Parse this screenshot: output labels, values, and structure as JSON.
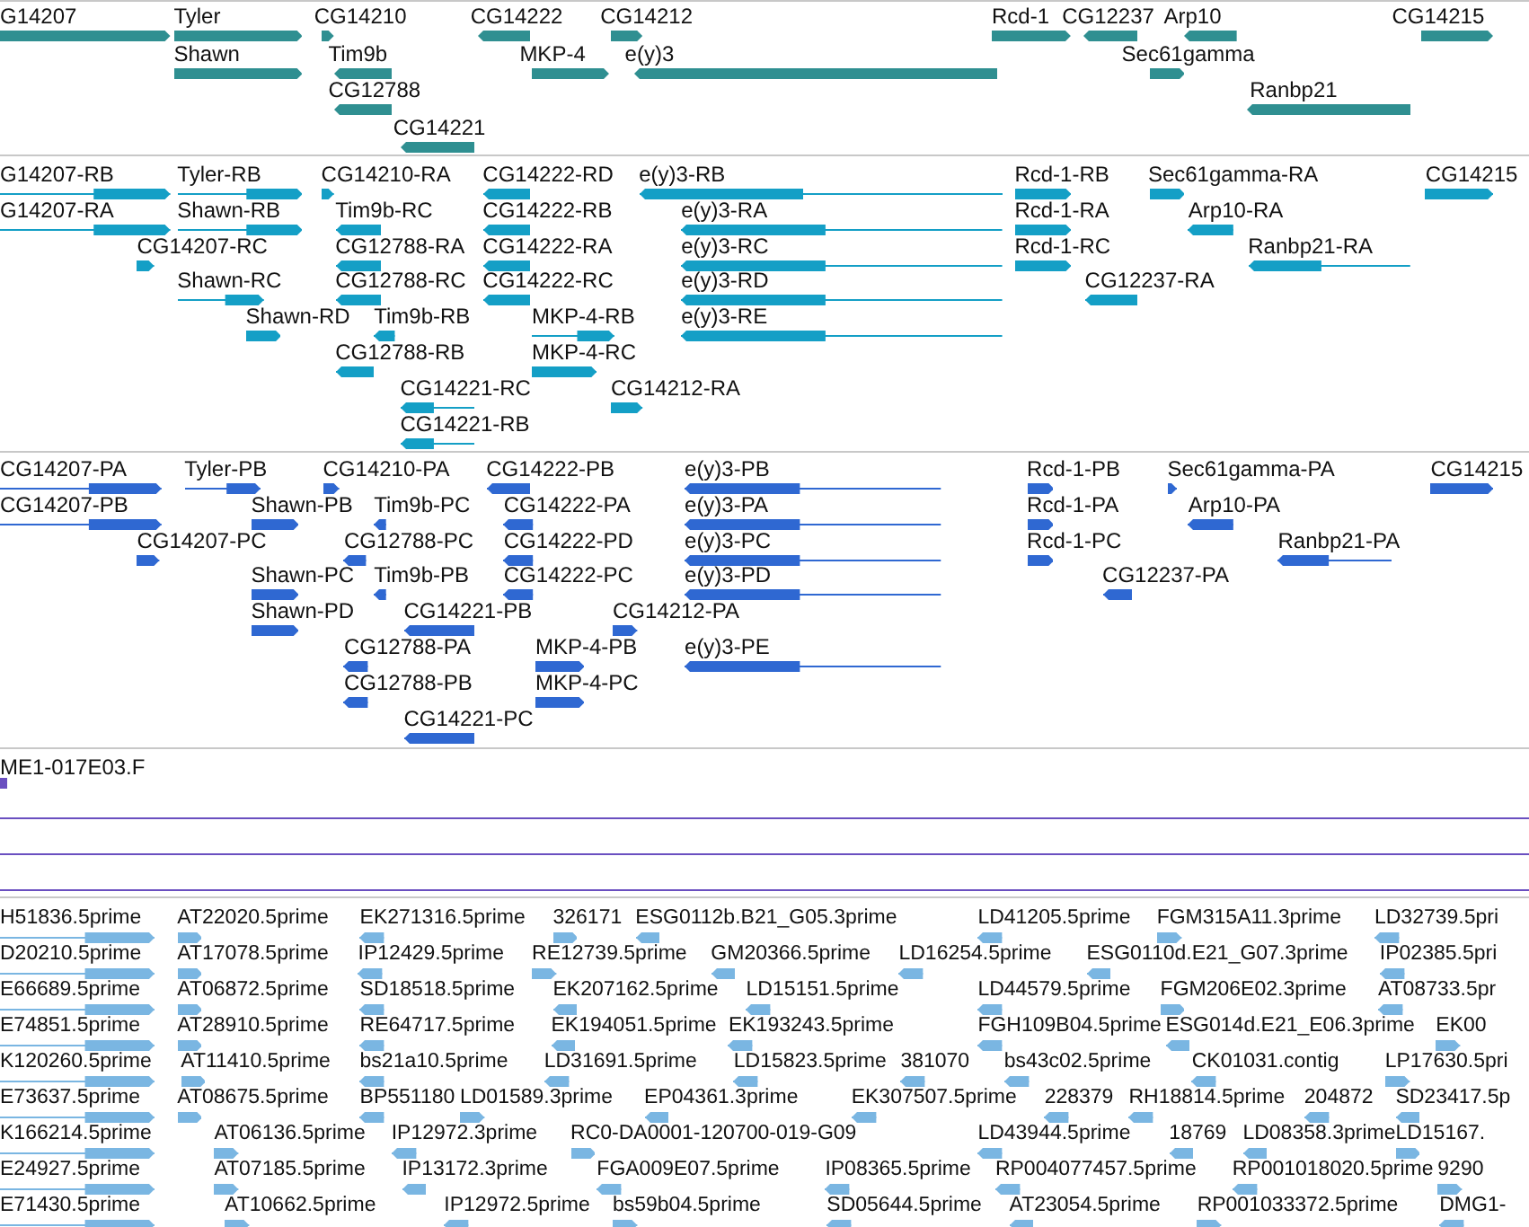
{
  "tracks": [
    {
      "kind": "gene",
      "features": [
        {
          "label": "G14207",
          "reverse": false
        },
        {
          "label": "Tyler",
          "reverse": false
        },
        {
          "label": "CG14210",
          "reverse": false
        },
        {
          "label": "CG14222",
          "reverse": true
        },
        {
          "label": "CG14212",
          "reverse": false
        },
        {
          "label": "Rcd-1",
          "reverse": false
        },
        {
          "label": "CG12237",
          "reverse": true
        },
        {
          "label": "Arp10",
          "reverse": true
        },
        {
          "label": "CG14215",
          "reverse": false
        },
        {
          "label": "Shawn",
          "reverse": false
        },
        {
          "label": "Tim9b",
          "reverse": true
        },
        {
          "label": "MKP-4",
          "reverse": false
        },
        {
          "label": "e(y)3",
          "reverse": true
        },
        {
          "label": "Sec61gamma",
          "reverse": false
        },
        {
          "label": "CG12788",
          "reverse": true
        },
        {
          "label": "Ranbp21",
          "reverse": true
        },
        {
          "label": "CG14221",
          "reverse": true
        }
      ]
    },
    {
      "kind": "transcript",
      "features": [
        {
          "label": "G14207-RB",
          "reverse": false
        },
        {
          "label": "Tyler-RB",
          "reverse": false
        },
        {
          "label": "CG14210-RA",
          "reverse": false
        },
        {
          "label": "CG14222-RD",
          "reverse": true
        },
        {
          "label": "e(y)3-RB",
          "reverse": true
        },
        {
          "label": "Rcd-1-RB",
          "reverse": false
        },
        {
          "label": "Sec61gamma-RA",
          "reverse": false
        },
        {
          "label": "CG14215",
          "reverse": false
        },
        {
          "label": "G14207-RA",
          "reverse": false
        },
        {
          "label": "Shawn-RB",
          "reverse": false
        },
        {
          "label": "Tim9b-RC",
          "reverse": true
        },
        {
          "label": "CG14222-RB",
          "reverse": true
        },
        {
          "label": "e(y)3-RA",
          "reverse": true
        },
        {
          "label": "Rcd-1-RA",
          "reverse": false
        },
        {
          "label": "Arp10-RA",
          "reverse": true
        },
        {
          "label": "CG14207-RC",
          "reverse": false
        },
        {
          "label": "CG12788-RA",
          "reverse": true
        },
        {
          "label": "CG14222-RA",
          "reverse": true
        },
        {
          "label": "e(y)3-RC",
          "reverse": true
        },
        {
          "label": "Rcd-1-RC",
          "reverse": false
        },
        {
          "label": "Ranbp21-RA",
          "reverse": true
        },
        {
          "label": "Shawn-RC",
          "reverse": false
        },
        {
          "label": "CG12788-RC",
          "reverse": true
        },
        {
          "label": "CG14222-RC",
          "reverse": true
        },
        {
          "label": "e(y)3-RD",
          "reverse": true
        },
        {
          "label": "CG12237-RA",
          "reverse": true
        },
        {
          "label": "Shawn-RD",
          "reverse": false
        },
        {
          "label": "Tim9b-RB",
          "reverse": true
        },
        {
          "label": "MKP-4-RB",
          "reverse": false
        },
        {
          "label": "e(y)3-RE",
          "reverse": true
        },
        {
          "label": "CG12788-RB",
          "reverse": true
        },
        {
          "label": "MKP-4-RC",
          "reverse": false
        },
        {
          "label": "CG14221-RC",
          "reverse": true
        },
        {
          "label": "CG14212-RA",
          "reverse": false
        },
        {
          "label": "CG14221-RB",
          "reverse": true
        }
      ]
    },
    {
      "kind": "protein",
      "features": [
        {
          "label": "CG14207-PA",
          "reverse": false
        },
        {
          "label": "Tyler-PB",
          "reverse": false
        },
        {
          "label": "CG14210-PA",
          "reverse": false
        },
        {
          "label": "CG14222-PB",
          "reverse": true
        },
        {
          "label": "e(y)3-PB",
          "reverse": true
        },
        {
          "label": "Rcd-1-PB",
          "reverse": false
        },
        {
          "label": "Sec61gamma-PA",
          "reverse": false
        },
        {
          "label": "CG14215",
          "reverse": false
        },
        {
          "label": "CG14207-PB",
          "reverse": false
        },
        {
          "label": "Shawn-PB",
          "reverse": false
        },
        {
          "label": "Tim9b-PC",
          "reverse": true
        },
        {
          "label": "CG14222-PA",
          "reverse": true
        },
        {
          "label": "e(y)3-PA",
          "reverse": true
        },
        {
          "label": "Rcd-1-PA",
          "reverse": false
        },
        {
          "label": "Arp10-PA",
          "reverse": true
        },
        {
          "label": "CG14207-PC",
          "reverse": false
        },
        {
          "label": "CG12788-PC",
          "reverse": true
        },
        {
          "label": "CG14222-PD",
          "reverse": true
        },
        {
          "label": "e(y)3-PC",
          "reverse": true
        },
        {
          "label": "Rcd-1-PC",
          "reverse": false
        },
        {
          "label": "Ranbp21-PA",
          "reverse": true
        },
        {
          "label": "Shawn-PC",
          "reverse": false
        },
        {
          "label": "Tim9b-PB",
          "reverse": true
        },
        {
          "label": "CG14222-PC",
          "reverse": true
        },
        {
          "label": "e(y)3-PD",
          "reverse": true
        },
        {
          "label": "CG12237-PA",
          "reverse": true
        },
        {
          "label": "Shawn-PD",
          "reverse": false
        },
        {
          "label": "CG14221-PB",
          "reverse": true
        },
        {
          "label": "CG14212-PA",
          "reverse": false
        },
        {
          "label": "CG12788-PA",
          "reverse": true
        },
        {
          "label": "MKP-4-PB",
          "reverse": false
        },
        {
          "label": "e(y)3-PE",
          "reverse": true
        },
        {
          "label": "CG12788-PB",
          "reverse": true
        },
        {
          "label": "MKP-4-PC",
          "reverse": false
        },
        {
          "label": "CG14221-PC",
          "reverse": true
        }
      ]
    },
    {
      "kind": "clone",
      "label": "ME1-017E03.F"
    },
    {
      "kind": "est",
      "features": [
        {
          "label": "H51836.5prime",
          "reverse": false
        },
        {
          "label": "AT22020.5prime",
          "reverse": false
        },
        {
          "label": "EK271316.5prime",
          "reverse": true
        },
        {
          "label": "326171",
          "reverse": false
        },
        {
          "label": "ESG0112b.B21_G05.3prime",
          "reverse": true
        },
        {
          "label": "LD41205.5prime",
          "reverse": true
        },
        {
          "label": "FGM315A11.3prime",
          "reverse": false
        },
        {
          "label": "LD32739.5pri",
          "reverse": true
        },
        {
          "label": "D20210.5prime",
          "reverse": false
        },
        {
          "label": "AT17078.5prime",
          "reverse": false
        },
        {
          "label": "IP12429.5prime",
          "reverse": true
        },
        {
          "label": "RE12739.5prime",
          "reverse": false
        },
        {
          "label": "GM20366.5prime",
          "reverse": true
        },
        {
          "label": "LD16254.5prime",
          "reverse": true
        },
        {
          "label": "ESG0110d.E21_G07.3prime",
          "reverse": true
        },
        {
          "label": "IP02385.5pri",
          "reverse": true
        },
        {
          "label": "E66689.5prime",
          "reverse": false
        },
        {
          "label": "AT06872.5prime",
          "reverse": false
        },
        {
          "label": "SD18518.5prime",
          "reverse": true
        },
        {
          "label": "EK207162.5prime",
          "reverse": true
        },
        {
          "label": "LD15151.5prime",
          "reverse": true
        },
        {
          "label": "LD44579.5prime",
          "reverse": true
        },
        {
          "label": "FGM206E02.3prime",
          "reverse": false
        },
        {
          "label": "AT08733.5pr",
          "reverse": true
        },
        {
          "label": "E74851.5prime",
          "reverse": false
        },
        {
          "label": "AT28910.5prime",
          "reverse": false
        },
        {
          "label": "RE64717.5prime",
          "reverse": true
        },
        {
          "label": "EK194051.5prime",
          "reverse": true
        },
        {
          "label": "EK193243.5prime",
          "reverse": true
        },
        {
          "label": "FGH109B04.5prime",
          "reverse": true
        },
        {
          "label": "ESG014d.E21_E06.3prime",
          "reverse": true
        },
        {
          "label": "EK00",
          "reverse": false
        },
        {
          "label": "K120260.5prime",
          "reverse": false
        },
        {
          "label": "AT11410.5prime",
          "reverse": false
        },
        {
          "label": "bs21a10.5prime",
          "reverse": true
        },
        {
          "label": "LD31691.5prime",
          "reverse": true
        },
        {
          "label": "LD15823.5prime",
          "reverse": true
        },
        {
          "label": "381070",
          "reverse": true
        },
        {
          "label": "bs43c02.5prime",
          "reverse": true
        },
        {
          "label": "CK01031.contig",
          "reverse": true
        },
        {
          "label": "LP17630.5pri",
          "reverse": false
        },
        {
          "label": "E73637.5prime",
          "reverse": false
        },
        {
          "label": "AT08675.5prime",
          "reverse": false
        },
        {
          "label": "BP551180",
          "reverse": true
        },
        {
          "label": "LD01589.3prime",
          "reverse": false
        },
        {
          "label": "EP04361.3prime",
          "reverse": true
        },
        {
          "label": "EK307507.5prime",
          "reverse": true
        },
        {
          "label": "228379",
          "reverse": true
        },
        {
          "label": "RH18814.5prime",
          "reverse": true
        },
        {
          "label": "204872",
          "reverse": true
        },
        {
          "label": "SD23417.5p",
          "reverse": true
        },
        {
          "label": "K166214.5prime",
          "reverse": false
        },
        {
          "label": "AT06136.5prime",
          "reverse": false
        },
        {
          "label": "IP12972.3prime",
          "reverse": true
        },
        {
          "label": "RC0-DA0001-120700-019-G09",
          "reverse": false
        },
        {
          "label": "LD43944.5prime",
          "reverse": true
        },
        {
          "label": "18769",
          "reverse": true
        },
        {
          "label": "LD08358.3prime",
          "reverse": true
        },
        {
          "label": "LD15167.",
          "reverse": false
        },
        {
          "label": "E24927.5prime",
          "reverse": false
        },
        {
          "label": "AT07185.5prime",
          "reverse": false
        },
        {
          "label": "IP13172.3prime",
          "reverse": true
        },
        {
          "label": "FGA009E07.5prime",
          "reverse": true
        },
        {
          "label": "IP08365.5prime",
          "reverse": true
        },
        {
          "label": "RP004077457.5prime",
          "reverse": true
        },
        {
          "label": "RP001018020.5prime",
          "reverse": true
        },
        {
          "label": "9290",
          "reverse": false
        },
        {
          "label": "E71430.5prime",
          "reverse": false
        },
        {
          "label": "AT10662.5prime",
          "reverse": false
        },
        {
          "label": "IP12972.5prime",
          "reverse": true
        },
        {
          "label": "bs59b04.5prime",
          "reverse": false
        },
        {
          "label": "SD05644.5prime",
          "reverse": true
        },
        {
          "label": "AT23054.5prime",
          "reverse": true
        },
        {
          "label": "RP001033372.5prime",
          "reverse": false
        },
        {
          "label": "DMG1-",
          "reverse": true
        }
      ]
    }
  ]
}
